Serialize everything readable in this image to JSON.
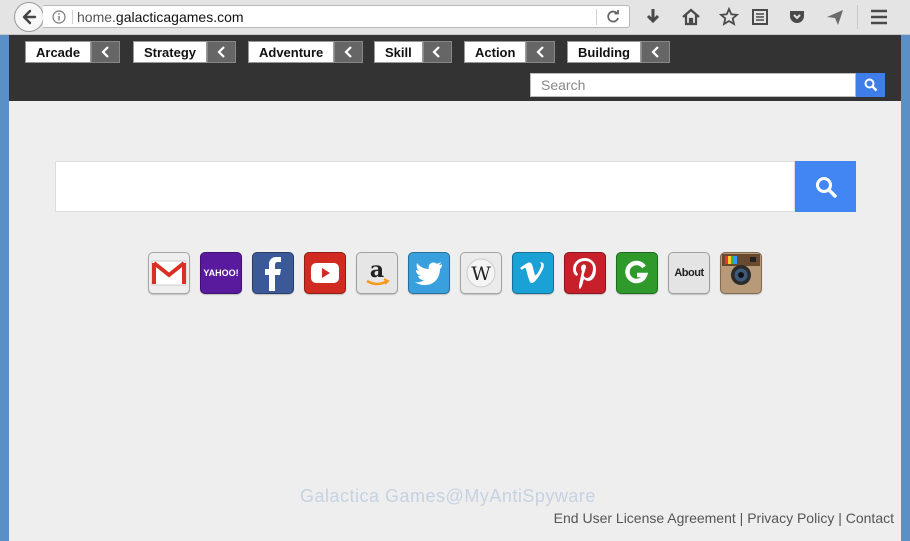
{
  "browser": {
    "url_prefix": "home.",
    "url_domain": "galacticagames.com"
  },
  "categories": [
    {
      "label": "Arcade"
    },
    {
      "label": "Strategy"
    },
    {
      "label": "Adventure"
    },
    {
      "label": "Skill"
    },
    {
      "label": "Action"
    },
    {
      "label": "Building"
    }
  ],
  "top_search": {
    "placeholder": "Search"
  },
  "tiles": [
    {
      "name": "gmail",
      "color": "#e8e8e8"
    },
    {
      "name": "yahoo",
      "label": "YAHOO!",
      "color": "#5a1a9e"
    },
    {
      "name": "facebook",
      "color": "#3b5998"
    },
    {
      "name": "youtube",
      "color": "#d12a20"
    },
    {
      "name": "amazon",
      "color": "#e6e6e6"
    },
    {
      "name": "twitter",
      "color": "#3aa0dd"
    },
    {
      "name": "wikipedia",
      "color": "#e9e9e9"
    },
    {
      "name": "vimeo",
      "color": "#1aa2d6"
    },
    {
      "name": "pinterest",
      "color": "#c8202a"
    },
    {
      "name": "grammarly",
      "color": "#2f9a2b"
    },
    {
      "name": "about",
      "label": "About",
      "color": "#e4e4e4"
    },
    {
      "name": "instagram",
      "color": "#b89a78"
    }
  ],
  "footer": {
    "eula": "End User License Agreement",
    "sep1": " | ",
    "privacy": "Privacy Policy",
    "sep2": " | ",
    "contact": "Contact"
  },
  "watermark": "Galactica Games@MyAntiSpyware"
}
